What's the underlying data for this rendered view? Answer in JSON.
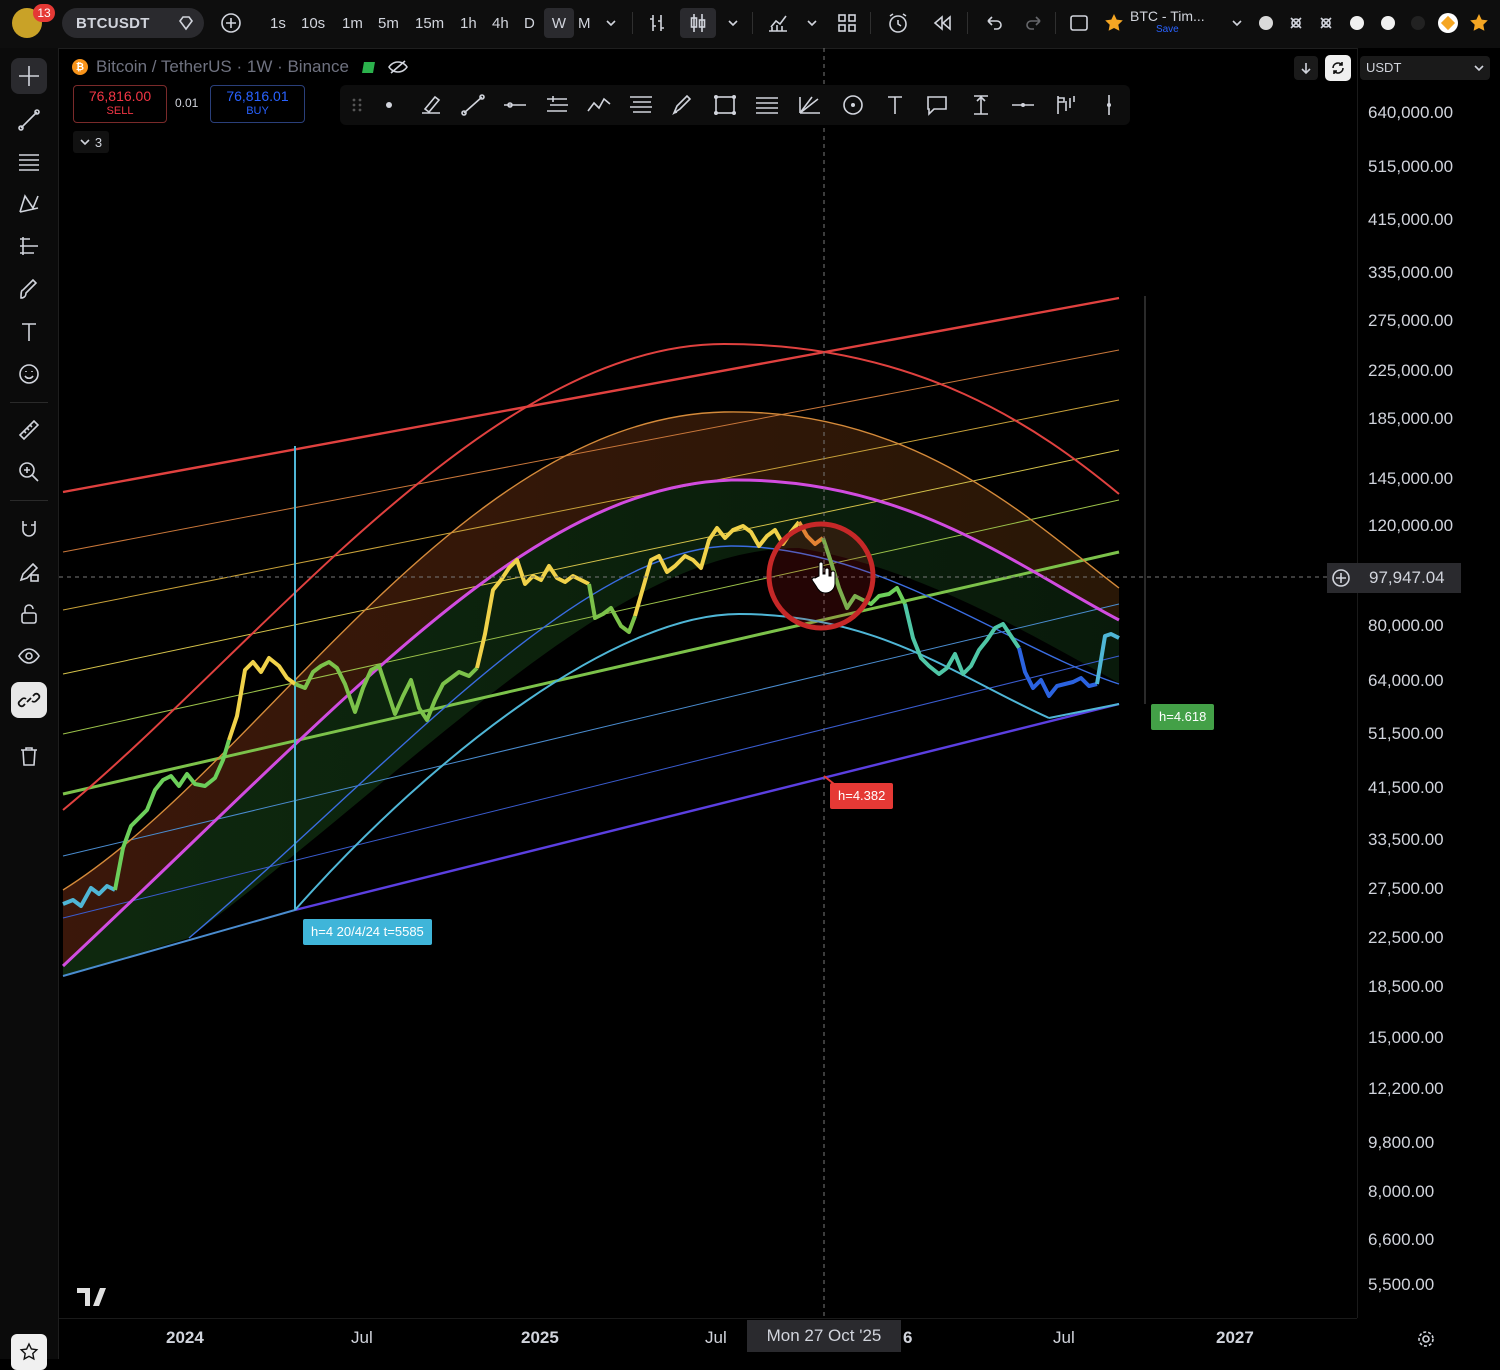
{
  "topbar": {
    "notification_count": "13",
    "symbol": "BTCUSDT",
    "timeframes": [
      "1s",
      "10s",
      "1m",
      "5m",
      "15m",
      "1h",
      "4h",
      "D",
      "W",
      "M"
    ],
    "active_timeframe": "W",
    "layout_name": "BTC - Tim...",
    "layout_save": "Save"
  },
  "legend": {
    "title": "Bitcoin / TetherUS · 1W · Binance",
    "indicators_count": "3"
  },
  "trade": {
    "sell_price": "76,816.00",
    "sell_label": "SELL",
    "spread": "0.01",
    "buy_price": "76,816.01",
    "buy_label": "BUY"
  },
  "scale": {
    "currency": "USDT",
    "prices": [
      "640,000.00",
      "515,000.00",
      "415,000.00",
      "335,000.00",
      "275,000.00",
      "225,000.00",
      "185,000.00",
      "145,000.00",
      "120,000.00",
      "97,947.04",
      "80,000.00",
      "64,000.00",
      "51,500.00",
      "41,500.00",
      "33,500.00",
      "27,500.00",
      "22,500.00",
      "18,500.00",
      "15,000.00",
      "12,200.00",
      "9,800.00",
      "8,000.00",
      "6,600.00",
      "5,500.00"
    ]
  },
  "crosshair": {
    "time": "Mon 27 Oct '25",
    "price": "97,947.04"
  },
  "time_axis": {
    "labels": [
      "2024",
      "Jul",
      "2025",
      "Jul",
      "6",
      "Jul",
      "2027"
    ]
  },
  "annotations": {
    "label_a": "h=4 20/4/24 t=5585",
    "label_b": "h=4.382",
    "label_c": "h=4.618"
  },
  "colors": {
    "background": "#000000",
    "red_line": "#e0413f",
    "magenta_curve": "#d14ce0",
    "cyan": "#4fb6d6",
    "green_band": "#7cc24a",
    "purple_line": "#5b3fe0",
    "label_cyan": "#3fb5d9",
    "label_red": "#e53935",
    "label_green": "#43a047"
  }
}
